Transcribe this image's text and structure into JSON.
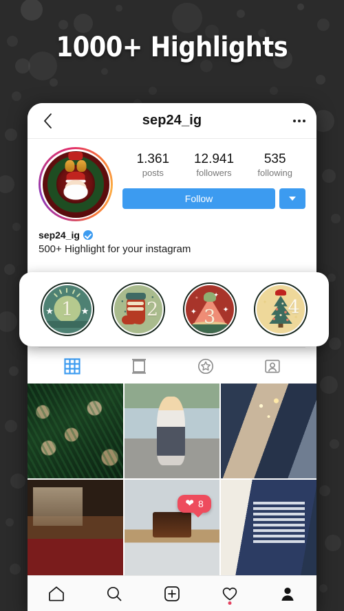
{
  "headline": "1000+ Highlights",
  "background": {
    "color": "#2b2b2b",
    "dot_color": "#6a6a6a"
  },
  "topbar": {
    "back_icon": "chevron-left-icon",
    "title": "sep24_ig",
    "menu_icon": "more-options-icon"
  },
  "profile": {
    "avatar_alt": "christmas-wreath-santa-avatar",
    "has_story_ring": true,
    "stats": [
      {
        "num": "1.361",
        "label": "posts"
      },
      {
        "num": "12.941",
        "label": "followers"
      },
      {
        "num": "535",
        "label": "following"
      }
    ],
    "follow_label": "Follow",
    "follow_color": "#3c9bf0",
    "dropdown_icon": "chevron-down-icon"
  },
  "bio": {
    "username": "sep24_ig",
    "verified": true,
    "description": "500+ Highlight for your instagram"
  },
  "highlights": [
    {
      "number": "1",
      "theme": "wreath-badge",
      "bg": "#4e8173"
    },
    {
      "number": "2",
      "theme": "stocking",
      "bg": "#a9bb8d"
    },
    {
      "number": "3",
      "theme": "tree-cone",
      "bg": "#a8342a"
    },
    {
      "number": "4",
      "theme": "christmas-tree",
      "bg": "#eed89a"
    }
  ],
  "tabs": [
    {
      "icon": "grid-icon",
      "active": true
    },
    {
      "icon": "carousel-icon",
      "active": false
    },
    {
      "icon": "star-circle-icon",
      "active": false
    },
    {
      "icon": "tagged-person-icon",
      "active": false
    }
  ],
  "grid": [
    {
      "alt": "christmas-tree-gold-ornaments"
    },
    {
      "alt": "woman-sitting-by-lake"
    },
    {
      "alt": "champagne-toast-sparklers"
    },
    {
      "alt": "family-christmas-dinner"
    },
    {
      "alt": "coffee-table-laptop"
    },
    {
      "alt": "person-reindeer-sweater-gift"
    }
  ],
  "like_badge": {
    "icon": "heart-icon",
    "count": "8",
    "color": "#ee4c5d"
  },
  "bottom_nav": [
    {
      "icon": "home-icon",
      "badge": false
    },
    {
      "icon": "search-icon",
      "badge": false
    },
    {
      "icon": "add-post-icon",
      "badge": false
    },
    {
      "icon": "heart-icon",
      "badge": true
    },
    {
      "icon": "profile-icon",
      "badge": false
    }
  ]
}
